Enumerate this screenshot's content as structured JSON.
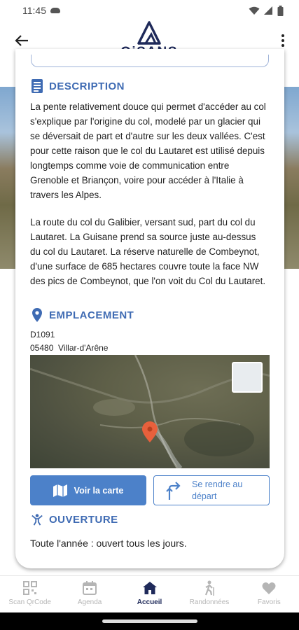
{
  "status_bar": {
    "time": "11:45"
  },
  "header": {
    "logo_text": "OiSANS"
  },
  "description": {
    "heading": "DESCRIPTION",
    "paragraph_1": "La pente relativement douce qui permet d'accéder au col s'explique par l'origine du col, modelé par un glacier qui se déversait de part et d'autre sur les deux vallées. C'est pour cette raison que le col du Lautaret est utilisé depuis longtemps comme voie de communication entre Grenoble et Briançon, voire pour accéder à l'Italie à travers les Alpes.",
    "paragraph_2": "La route du col du Galibier, versant sud, part du col du Lautaret. La Guisane prend sa source juste au-dessus du col du Lautaret. La réserve naturelle de Combeynot, d'une surface de 685 hectares couvre toute la face NW des pics de Combeynot, que l'on voit du Col du Lautaret."
  },
  "location": {
    "heading": "EMPLACEMENT",
    "road": "D1091",
    "postcode_city": "05480  Villar-d'Arêne"
  },
  "actions": {
    "view_map": "Voir la carte",
    "go_to_start": "Se rendre au départ"
  },
  "opening": {
    "heading": "OUVERTURE",
    "text": "Toute l'année : ouvert tous les jours."
  },
  "bottom_nav": [
    {
      "label": "Scan QrCode",
      "icon": "qr-code-icon"
    },
    {
      "label": "Agenda",
      "icon": "calendar-icon"
    },
    {
      "label": "Accueil",
      "icon": "home-icon",
      "active": true
    },
    {
      "label": "Randonnées",
      "icon": "hiker-icon"
    },
    {
      "label": "Favoris",
      "icon": "heart-icon"
    }
  ],
  "colors": {
    "accent": "#4c81c9",
    "brand_dark": "#1f2a5a",
    "heading_blue": "#3f6bb3",
    "map_pin": "#e8603c"
  }
}
